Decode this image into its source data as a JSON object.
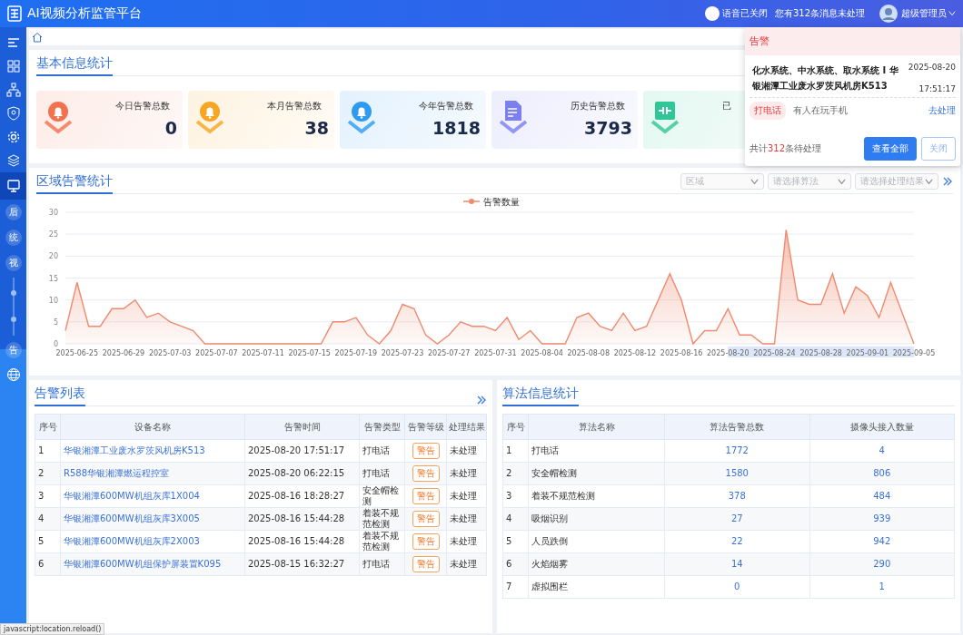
{
  "header": {
    "title": "AI视频分析监管平台",
    "voice_toggle": {
      "label": "语音已关闭",
      "on": false
    },
    "messages": "您有312条消息未处理",
    "user": "超级管理员"
  },
  "sidebar": {
    "items": [
      {
        "kind": "menu",
        "selected": false
      },
      {
        "kind": "grid",
        "selected": false
      },
      {
        "kind": "tree",
        "selected": false
      },
      {
        "kind": "shield",
        "selected": false
      },
      {
        "kind": "gear",
        "selected": false
      },
      {
        "kind": "layers",
        "selected": false
      },
      {
        "kind": "monitor",
        "selected": true
      },
      {
        "kind": "text",
        "label": "后",
        "selected": false
      },
      {
        "kind": "text",
        "label": "统",
        "selected": false
      },
      {
        "kind": "text",
        "label": "视",
        "selected": false
      },
      {
        "kind": "slider",
        "selected": false
      },
      {
        "kind": "text",
        "label": "告",
        "selected": false
      },
      {
        "kind": "globe",
        "selected": false
      }
    ]
  },
  "basic_stats": {
    "title": "基本信息统计",
    "cards": [
      {
        "kind": "bell",
        "label": "今日告警总数",
        "value": "0",
        "color": "#f2714f"
      },
      {
        "kind": "bell",
        "label": "本月告警总数",
        "value": "38",
        "color": "#f6a623"
      },
      {
        "kind": "bell",
        "label": "今年告警总数",
        "value": "1818",
        "color": "#2f9bf0"
      },
      {
        "kind": "document",
        "label": "历史告警总数",
        "value": "3793",
        "color": "#7b7ff0"
      },
      {
        "kind": "plug",
        "label": "已",
        "color": "#2fc795"
      }
    ]
  },
  "region_chart": {
    "title": "区域告警统计",
    "filters": [
      {
        "placeholder": "区域"
      },
      {
        "placeholder": "请选择算法"
      },
      {
        "placeholder": "请选择处理结果"
      }
    ],
    "chart_data": {
      "type": "area",
      "grid": true,
      "categories": [
        null,
        "2025-06-25",
        null,
        null,
        null,
        "2025-06-29",
        null,
        null,
        null,
        "2025-07-03",
        null,
        null,
        null,
        "2025-07-07",
        null,
        null,
        null,
        "2025-07-11",
        null,
        null,
        null,
        "2025-07-15",
        null,
        null,
        null,
        "2025-07-19",
        null,
        null,
        null,
        "2025-07-23",
        null,
        null,
        null,
        "2025-07-27",
        null,
        null,
        null,
        "2025-07-31",
        null,
        null,
        null,
        "2025-08-04",
        null,
        null,
        null,
        "2025-08-08",
        null,
        null,
        null,
        "2025-08-12",
        null,
        null,
        null,
        "2025-08-16",
        null,
        null,
        null,
        "2025-08-20",
        null,
        null,
        null,
        "2025-08-24",
        null,
        null,
        null,
        "2025-08-28",
        null,
        null,
        null,
        "2025-09-01",
        null,
        null,
        null,
        "2025-09-05"
      ],
      "series": [
        {
          "name": "告警数量",
          "color": "#ef8a6f",
          "values": [
            3,
            14,
            4,
            4,
            8,
            8,
            10,
            6,
            7,
            5,
            4,
            3,
            0,
            0,
            0,
            0,
            0,
            0,
            0,
            0,
            0,
            0,
            0,
            5,
            5,
            6,
            2,
            0,
            3,
            9,
            8,
            2,
            0,
            2,
            5,
            4,
            4,
            3,
            6,
            1,
            3,
            0,
            0,
            0,
            6,
            7,
            4,
            3,
            7,
            3,
            4,
            10,
            16,
            10,
            0,
            3,
            3,
            8,
            2,
            2,
            0,
            0,
            26,
            10,
            9,
            9,
            16,
            7,
            13,
            11,
            6,
            14,
            7,
            0
          ]
        }
      ],
      "ylim": [
        0,
        30
      ],
      "yticks": [
        0,
        5,
        10,
        15,
        20,
        25,
        30
      ]
    }
  },
  "alert_list": {
    "title": "告警列表",
    "columns": [
      "序号",
      "设备名称",
      "告警时间",
      "告警类型",
      "告警等级",
      "处理结果"
    ],
    "rows": [
      {
        "no": "1",
        "device": "华银湘潭工业废水罗茨风机房K513",
        "time": "2025-08-20 17:51:17",
        "type": "打电话",
        "level": "警告",
        "result": "未处理"
      },
      {
        "no": "2",
        "device": "R588华银湘潭燃运程控室",
        "time": "2025-08-20 06:22:15",
        "type": "打电话",
        "level": "警告",
        "result": "未处理"
      },
      {
        "no": "3",
        "device": "华银湘潭600MW机组灰库1X004",
        "time": "2025-08-16 18:28:27",
        "type": "安全帽检测",
        "level": "警告",
        "result": "未处理"
      },
      {
        "no": "4",
        "device": "华银湘潭600MW机组灰库3X005",
        "time": "2025-08-16 15:44:28",
        "type": "着装不规范检测",
        "level": "警告",
        "result": "未处理"
      },
      {
        "no": "5",
        "device": "华银湘潭600MW机组灰库2X003",
        "time": "2025-08-16 15:44:28",
        "type": "着装不规范检测",
        "level": "警告",
        "result": "未处理"
      },
      {
        "no": "6",
        "device": "华银湘潭600MW机组保护屏装置K095",
        "time": "2025-08-15 16:32:27",
        "type": "打电话",
        "level": "警告",
        "result": "未处理"
      }
    ]
  },
  "algorithm_stats": {
    "title": "算法信息统计",
    "columns": [
      "序号",
      "算法名称",
      "算法告警总数",
      "摄像头接入数量"
    ],
    "rows": [
      {
        "no": "1",
        "name": "打电话",
        "alerts": "1772",
        "cameras": "4"
      },
      {
        "no": "2",
        "name": "安全帽检测",
        "alerts": "1580",
        "cameras": "806"
      },
      {
        "no": "3",
        "name": "着装不规范检测",
        "alerts": "378",
        "cameras": "484"
      },
      {
        "no": "4",
        "name": "吸烟识别",
        "alerts": "27",
        "cameras": "939"
      },
      {
        "no": "5",
        "name": "人员跌倒",
        "alerts": "22",
        "cameras": "942"
      },
      {
        "no": "6",
        "name": "火焰烟雾",
        "alerts": "14",
        "cameras": "290"
      },
      {
        "no": "7",
        "name": "虚拟围栏",
        "alerts": "0",
        "cameras": "1"
      }
    ]
  },
  "popup": {
    "title": "告警",
    "message": "化水系统、中水系统、取水系统 I 华银湘潭工业废水罗茨风机房K513",
    "date": "2025-08-20",
    "time": "17:51:17",
    "tag": "打电话",
    "description": "有人在玩手机",
    "action": "去处理",
    "total_prefix": "共计",
    "total_count": "312",
    "total_suffix": "条待处理",
    "buttons": [
      {
        "label": "查看全部",
        "kind": "primary"
      },
      {
        "label": "关闭",
        "kind": "secondary"
      }
    ]
  },
  "status_bar": "javascript:location.reload()"
}
